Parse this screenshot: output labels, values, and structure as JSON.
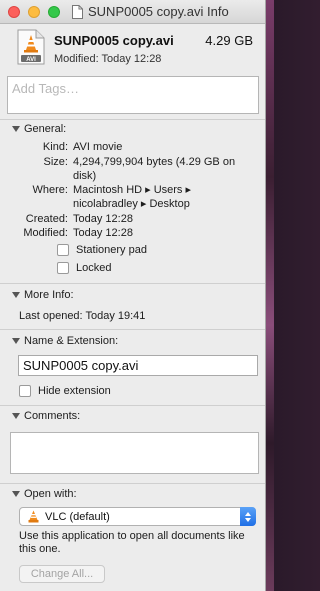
{
  "window": {
    "title": "SUNP0005 copy.avi Info"
  },
  "file": {
    "name": "SUNP0005 copy.avi",
    "size": "4.29 GB",
    "modified_summary": "Modified: Today 12:28"
  },
  "tags": {
    "placeholder": "Add Tags…"
  },
  "general": {
    "header": "General:",
    "kind_label": "Kind:",
    "kind_value": "AVI movie",
    "size_label": "Size:",
    "size_value_line1": "4,294,799,904 bytes (4.29 GB on",
    "size_value_line2": "disk)",
    "where_label": "Where:",
    "where_value_line1": "Macintosh HD ▸ Users ▸",
    "where_value_line2": "nicolabradley ▸ Desktop",
    "created_label": "Created:",
    "created_value": "Today 12:28",
    "modified_label": "Modified:",
    "modified_value": "Today 12:28",
    "stationery_label": "Stationery pad",
    "locked_label": "Locked"
  },
  "more_info": {
    "header": "More Info:",
    "last_opened": "Last opened: Today 19:41"
  },
  "name_extension": {
    "header": "Name & Extension:",
    "value": "SUNP0005 copy.avi",
    "hide_extension_label": "Hide extension"
  },
  "comments": {
    "header": "Comments:"
  },
  "open_with": {
    "header": "Open with:",
    "selected": "VLC (default)",
    "note": "Use this application to open all documents like this one.",
    "change_all_label": "Change All..."
  }
}
